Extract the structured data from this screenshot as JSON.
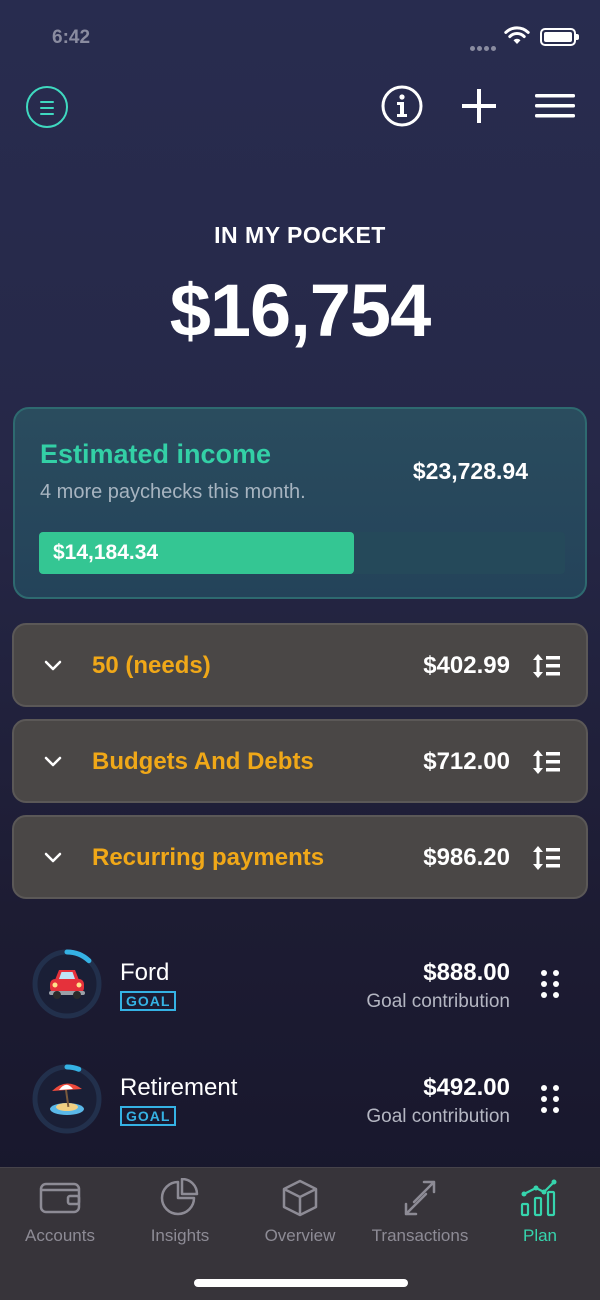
{
  "status_bar": {
    "time": "6:42"
  },
  "header": {
    "balance_label": "IN MY POCKET",
    "balance_value": "$16,754"
  },
  "income": {
    "title": "Estimated income",
    "subtitle": "4 more paychecks this month.",
    "total": "$23,728.94",
    "received": "$14,184.34",
    "progress_fraction": 0.598
  },
  "categories": [
    {
      "name": "50 (needs)",
      "amount": "$402.99"
    },
    {
      "name": "Budgets And Debts",
      "amount": "$712.00"
    },
    {
      "name": "Recurring payments",
      "amount": "$986.20"
    }
  ],
  "goals": [
    {
      "name": "Ford",
      "badge": "GOAL",
      "amount": "$888.00",
      "subtitle": "Goal contribution",
      "emoji_icon": "car-icon",
      "progress_fraction": 0.12
    },
    {
      "name": "Retirement",
      "badge": "GOAL",
      "amount": "$492.00",
      "subtitle": "Goal contribution",
      "emoji_icon": "beach-umbrella-icon",
      "progress_fraction": 0.06
    }
  ],
  "tabs": [
    {
      "label": "Accounts",
      "icon": "wallet-icon",
      "active": false
    },
    {
      "label": "Insights",
      "icon": "pie-chart-icon",
      "active": false
    },
    {
      "label": "Overview",
      "icon": "cube-icon",
      "active": false
    },
    {
      "label": "Transactions",
      "icon": "transfer-arrows-icon",
      "active": false
    },
    {
      "label": "Plan",
      "icon": "plan-chart-icon",
      "active": true
    }
  ],
  "colors": {
    "accent": "#36d4ad",
    "category_title": "#f0a818",
    "goal_badge": "#35b2e4",
    "progress_fill": "#34c693"
  }
}
